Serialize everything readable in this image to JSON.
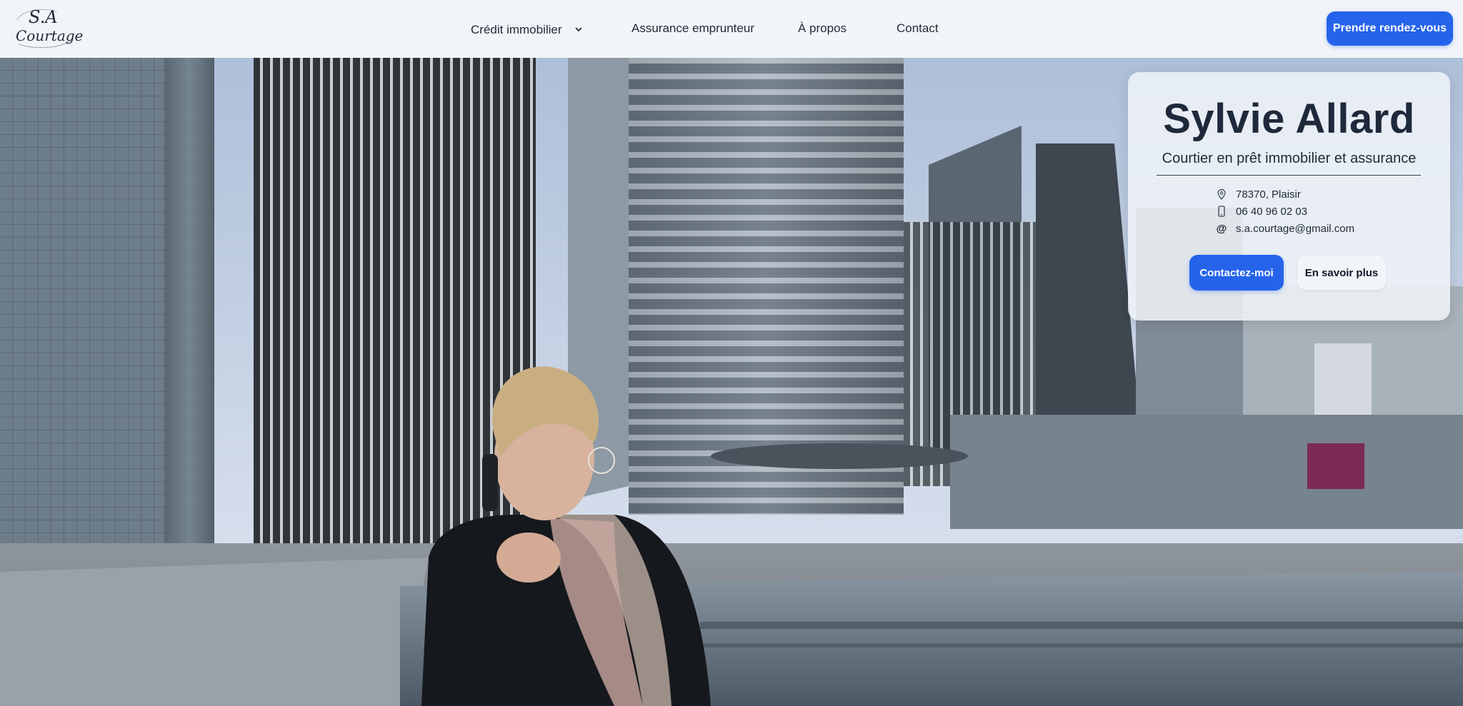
{
  "brand": {
    "logo_line1": "S.A",
    "logo_line2": "Courtage"
  },
  "nav": {
    "items": [
      {
        "label": "Crédit immobilier",
        "has_dropdown": true
      },
      {
        "label": "Assurance emprunteur"
      },
      {
        "label": "À propos"
      },
      {
        "label": "Contact"
      }
    ],
    "cta_label": "Prendre rendez-vous"
  },
  "hero": {
    "image_icon": "hero-photo-woman-on-phone-business-district",
    "name": "Sylvie Allard",
    "subtitle": "Courtier en prêt immobilier et assurance",
    "address": "78370, Plaisir",
    "phone": "06 40 96 02 03",
    "email": "s.a.courtage@gmail.com",
    "contact_button": "Contactez-moi",
    "more_button": "En savoir plus"
  },
  "colors": {
    "accent": "#2563eb",
    "nav_bg": "#f1f5f9",
    "text_dark": "#1e293b"
  }
}
